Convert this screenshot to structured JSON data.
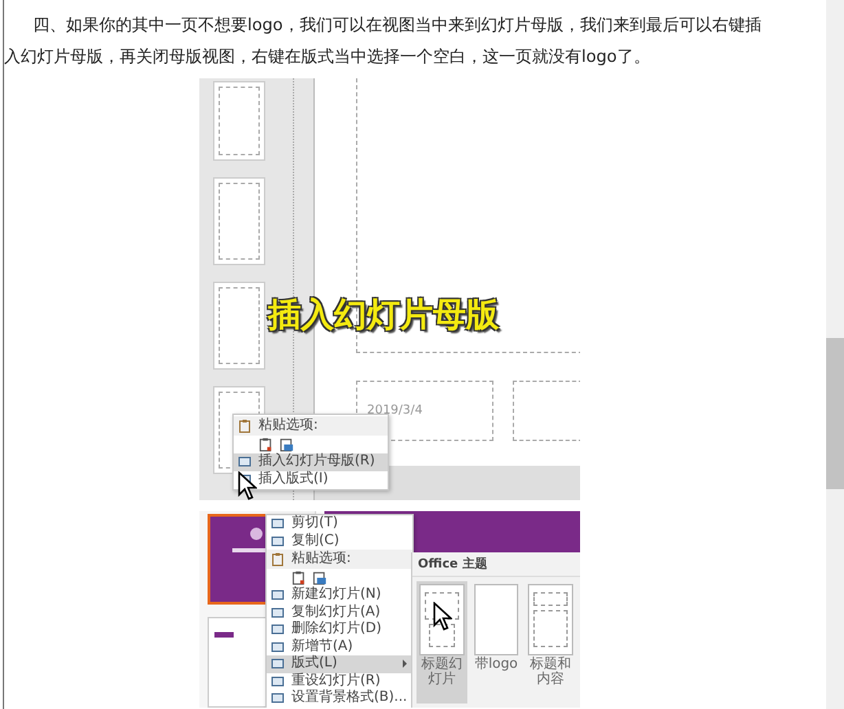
{
  "article": {
    "paragraph": "四、如果你的其中一页不想要logo，我们可以在视图当中来到幻灯片母版，我们来到最后可以右键插入幻灯片母版，再关闭母版视图，右键在版式当中选择一个空白，这一页就没有logo了。"
  },
  "figure_1": {
    "caption": "插入幻灯片母版",
    "date_placeholder": "2019/3/4",
    "context_menu": [
      {
        "kind": "header",
        "label": "粘贴选项:"
      },
      {
        "kind": "paste_icons"
      },
      {
        "kind": "item",
        "label": "插入幻灯片母版(R)",
        "selected": true
      },
      {
        "kind": "item",
        "label": "插入版式(I)",
        "selected": false
      }
    ]
  },
  "figure_2": {
    "context_menu": [
      {
        "kind": "item",
        "label": "剪切(T)",
        "selected": false
      },
      {
        "kind": "item",
        "label": "复制(C)",
        "selected": false
      },
      {
        "kind": "header",
        "label": "粘贴选项:"
      },
      {
        "kind": "paste_icons"
      },
      {
        "kind": "item",
        "label": "新建幻灯片(N)",
        "selected": false
      },
      {
        "kind": "item",
        "label": "复制幻灯片(A)",
        "selected": false
      },
      {
        "kind": "item",
        "label": "删除幻灯片(D)",
        "selected": false
      },
      {
        "kind": "item",
        "label": "新增节(A)",
        "selected": false
      },
      {
        "kind": "submenu",
        "label": "版式(L)",
        "selected": true
      },
      {
        "kind": "item",
        "label": "重设幻灯片(R)",
        "selected": false
      },
      {
        "kind": "item",
        "label": "设置背景格式(B)...",
        "selected": false
      }
    ],
    "layout_gallery": {
      "title": "Office 主题",
      "layouts": [
        {
          "label": "标题幻灯片",
          "selected": true
        },
        {
          "label": "带logo",
          "selected": false
        },
        {
          "label": "标题和内容",
          "selected": false
        }
      ]
    }
  }
}
